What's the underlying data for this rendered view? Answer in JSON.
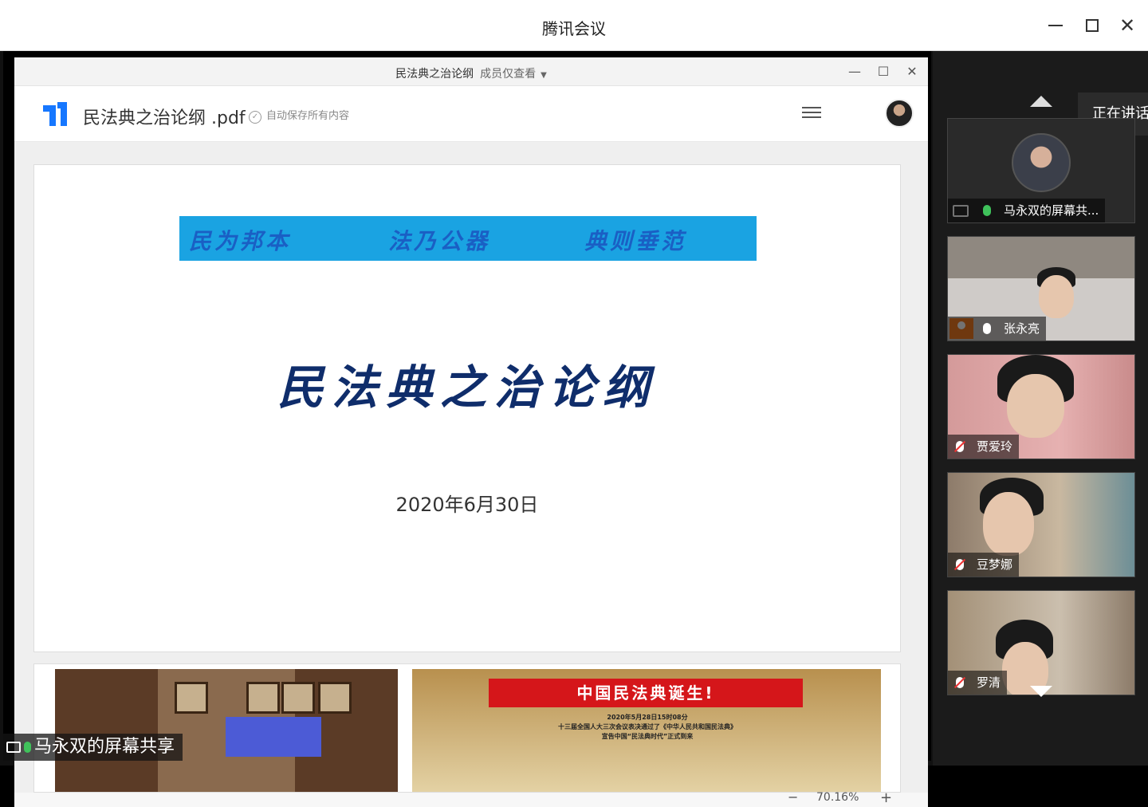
{
  "window": {
    "title": "腾讯会议"
  },
  "shared_window": {
    "title": "民法典之治论纲",
    "permission": "成员仅查看",
    "app": {
      "filename": "民法典之治论纲 .pdf",
      "autosave": "自动保存所有内容"
    },
    "page1": {
      "mottos": [
        "民为邦本",
        "法乃公器",
        "典则垂范"
      ],
      "title": "民法典之治论纲",
      "date": "2020年6月30日"
    },
    "page2": {
      "ribbon": "中国民法典诞生!",
      "lines": [
        "2020年5月28日15时08分",
        "十三届全国人大三次会议表决通过了《中华人民共和国民法典》",
        "宣告中国“民法典时代”正式到来"
      ]
    },
    "zoom": {
      "minus": "−",
      "value": "70.16%",
      "plus": "+"
    }
  },
  "sharer_label": "马永双的屏幕共享",
  "gallery": {
    "speaking_label": "正在讲话",
    "tiles": [
      {
        "name": "马永双的屏幕共...",
        "mic": "on"
      },
      {
        "name": "张永亮",
        "mic": "on-white"
      },
      {
        "name": "贾爱玲",
        "mic": "muted"
      },
      {
        "name": "豆梦娜",
        "mic": "muted"
      },
      {
        "name": "罗清",
        "mic": "muted"
      }
    ]
  },
  "colors": {
    "banner": "#1aa3e2",
    "title_text": "#0f2d6b",
    "ribbon": "#d5161a",
    "mic_green": "#3fc25b",
    "host_orange": "#f57c22"
  }
}
